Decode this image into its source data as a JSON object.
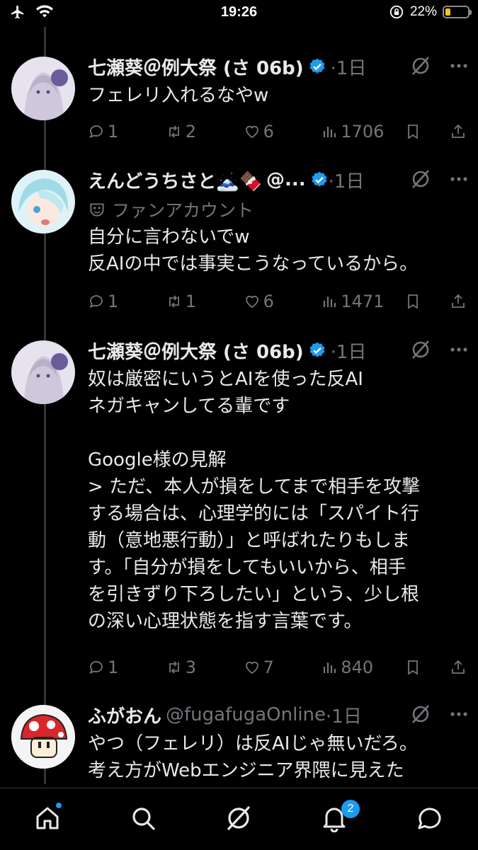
{
  "status_bar": {
    "time": "19:26",
    "battery_percent": "22%",
    "battery_level": 0.22
  },
  "tweets": [
    {
      "name": "七瀬葵＠例大祭 (さ 06b)",
      "handle": "",
      "time": "·1日",
      "body": "フェレリ入れるなやw",
      "fan_label": "",
      "replies": "1",
      "retweets": "2",
      "likes": "6",
      "views": "1706"
    },
    {
      "name": "えんどうちさと🗻🍫",
      "handle": "@...",
      "time": "·1日",
      "fan_label": "ファンアカウント",
      "body": "自分に言わないでw\n反AIの中では事実こうなっているから。",
      "replies": "1",
      "retweets": "1",
      "likes": "6",
      "views": "1471"
    },
    {
      "name": "七瀬葵＠例大祭 (さ 06b)",
      "handle": "",
      "time": "·1日",
      "fan_label": "",
      "body": "奴は厳密にいうとAIを使った反AI\nネガキャンしてる輩です\n\nGoogle様の見解\n> ただ、本人が損をしてまで相手を攻撃\nする場合は、心理学的には「スパイト行\n動（意地悪行動）」と呼ばれたりもしま\nす。「自分が損をしてもいいから、相手\nを引きずり下ろしたい」という、少し根\nの深い心理状態を指す言葉です。",
      "replies": "1",
      "retweets": "3",
      "likes": "7",
      "views": "840"
    },
    {
      "name": "ふがおん",
      "handle": "@fugafugaOnline",
      "time": "·1日",
      "fan_label": "",
      "body": "やつ（フェレリ）は反AIじゃ無いだろ。\n考え方がWebエンジニア界隈に見えた",
      "replies": "",
      "retweets": "",
      "likes": "",
      "views": ""
    }
  ],
  "bottom_nav": {
    "notifications_badge": "2"
  },
  "colors": {
    "accent": "#1d9bf0",
    "muted": "#71767b",
    "text": "#e7e9ea",
    "background": "#000000"
  },
  "icons": [
    "airplane-icon",
    "wifi-icon",
    "rotation-lock-icon",
    "battery-icon",
    "verified-badge-icon",
    "grok-icon",
    "more-icon",
    "reply-icon",
    "retweet-icon",
    "like-icon",
    "views-icon",
    "bookmark-icon",
    "share-icon",
    "home-icon",
    "search-icon",
    "notifications-icon",
    "messages-icon",
    "fan-mask-icon"
  ]
}
